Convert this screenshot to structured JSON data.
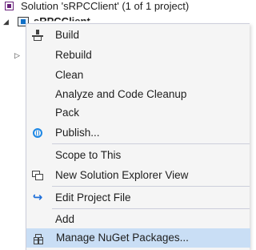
{
  "tree": {
    "solution_label": "Solution 'sRPCClient' (1 of 1 project)",
    "project_label": "sRPCClient"
  },
  "menu": {
    "items": {
      "build": "Build",
      "rebuild": "Rebuild",
      "clean": "Clean",
      "analyze": "Analyze and Code Cleanup",
      "pack": "Pack",
      "publish": "Publish...",
      "scope": "Scope to This",
      "new_view": "New Solution Explorer View",
      "edit_project": "Edit Project File",
      "add": "Add",
      "manage_nuget": "Manage NuGet Packages..."
    },
    "icons": {
      "build": "build-icon",
      "publish": "globe-icon",
      "new_view": "solution-explorer-icon",
      "edit_project": "edit-project-icon",
      "manage_nuget": "nuget-package-icon"
    },
    "highlighted": "manage_nuget",
    "colors": {
      "highlight": "#c9def5",
      "menu_bg": "#f5f5f5",
      "separator": "#cccedb"
    }
  }
}
